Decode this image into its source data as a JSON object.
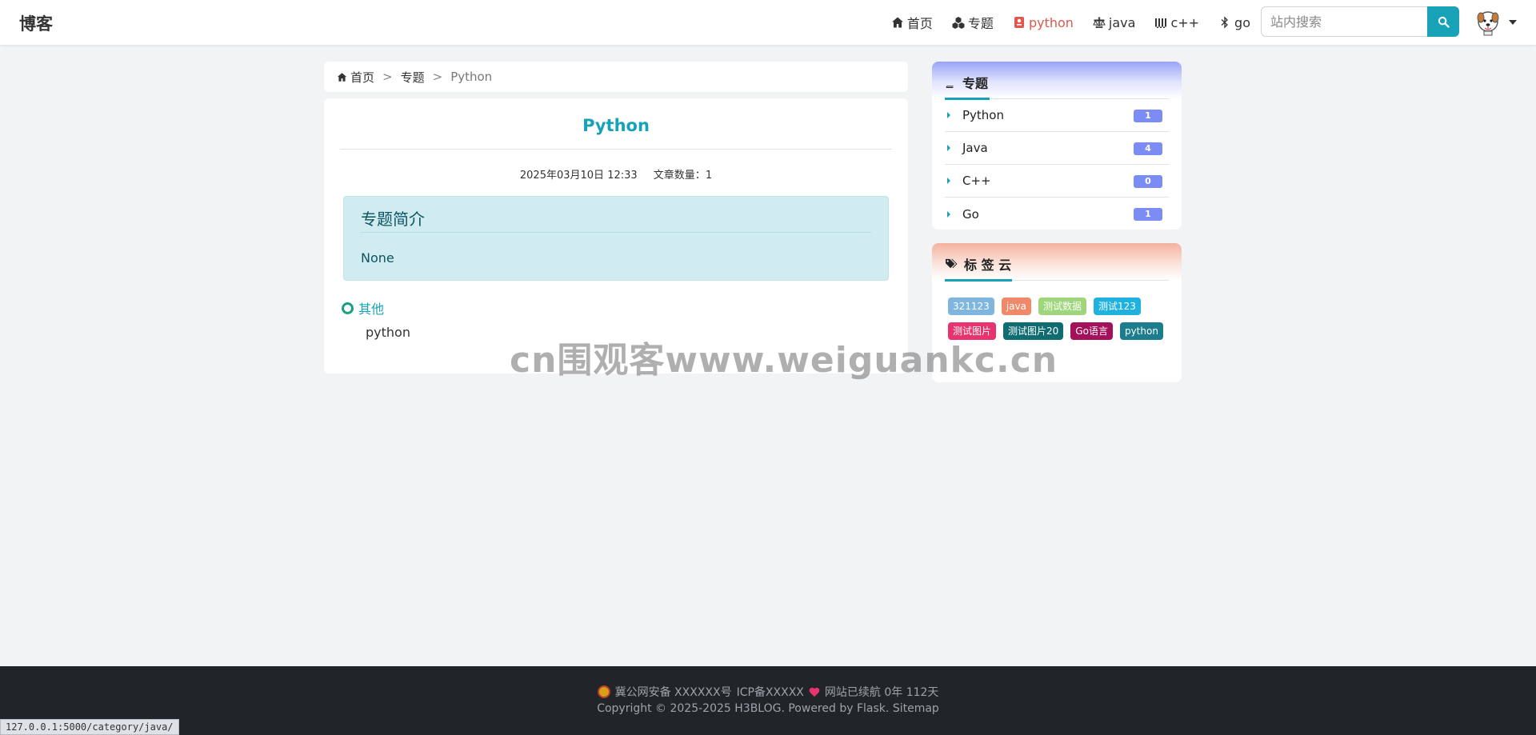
{
  "navbar": {
    "brand": "博客",
    "items": [
      {
        "label": "首页",
        "icon": "home-icon"
      },
      {
        "label": "专题",
        "icon": "cubes-icon"
      },
      {
        "label": "python",
        "icon": "python-icon"
      },
      {
        "label": "java",
        "icon": "balance-scale-icon"
      },
      {
        "label": "c++",
        "icon": "industry-icon"
      },
      {
        "label": "go",
        "icon": "bluetooth-icon"
      }
    ],
    "active_item": "python",
    "search_placeholder": "站内搜索"
  },
  "breadcrumb": {
    "home": "首页",
    "separator": ">",
    "level1": "专题",
    "current": "Python"
  },
  "main": {
    "title": "Python",
    "date": "2025年03月10日 12:33",
    "article_count_label": "文章数量：",
    "article_count": "1",
    "intro_title": "专题简介",
    "intro_body": "None",
    "section_label": "其他",
    "articles": [
      "python"
    ]
  },
  "sidebar": {
    "categories_title": "专题",
    "categories": [
      {
        "name": "Python",
        "count": "1"
      },
      {
        "name": "Java",
        "count": "4"
      },
      {
        "name": "C++",
        "count": "0"
      },
      {
        "name": "Go",
        "count": "1"
      }
    ],
    "tags_title": "标 签 云",
    "tags": [
      {
        "label": "321123",
        "color": "#7eb6e0"
      },
      {
        "label": "java",
        "color": "#f0886a"
      },
      {
        "label": "测试数据",
        "color": "#9fd67c"
      },
      {
        "label": "测试123",
        "color": "#1fb2de"
      },
      {
        "label": "测试图片",
        "color": "#e8336e"
      },
      {
        "label": "测试图片20",
        "color": "#0f6d72"
      },
      {
        "label": "Go语言",
        "color": "#a5105b"
      },
      {
        "label": "python",
        "color": "#1b7d8e"
      }
    ]
  },
  "watermark": "cn围观客www.weiguankc.cn",
  "footer": {
    "police_record": "冀公网安备 XXXXXX号",
    "icp": "ICP备XXXXX",
    "uptime": "网站已续航 0年 112天",
    "copyright": "Copyright © 2025-2025 H3BLOG. Powered by",
    "powered": "Flask",
    "sitemap": "Sitemap"
  },
  "status_url": "127.0.0.1:5000/category/java/",
  "colors": {
    "accent": "#17a2b8",
    "active_nav": "#e2574c",
    "badge": "#7b8cf5",
    "footer_bg": "#212529"
  }
}
